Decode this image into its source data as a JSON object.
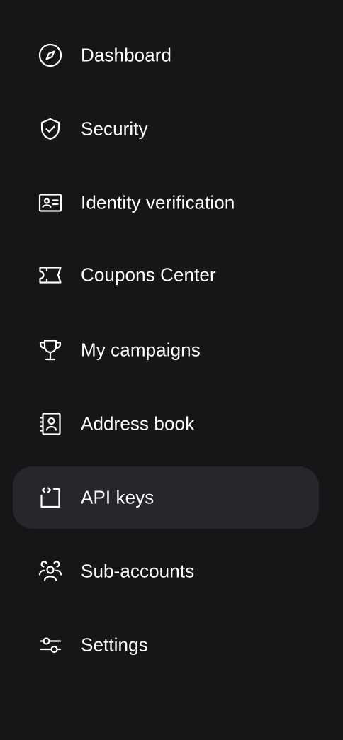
{
  "colors": {
    "background": "#161618",
    "active_item_background": "#26272b",
    "text": "#ffffff"
  },
  "sidebar": {
    "active_index": 6,
    "items": [
      {
        "label": "Dashboard",
        "icon": "compass-icon"
      },
      {
        "label": "Security",
        "icon": "shield-check-icon"
      },
      {
        "label": "Identity verification",
        "icon": "id-card-icon"
      },
      {
        "label": "Coupons Center",
        "icon": "ticket-icon"
      },
      {
        "label": "My campaigns",
        "icon": "trophy-icon"
      },
      {
        "label": "Address book",
        "icon": "contact-book-icon"
      },
      {
        "label": "API keys",
        "icon": "api-code-icon"
      },
      {
        "label": "Sub-accounts",
        "icon": "users-icon"
      },
      {
        "label": "Settings",
        "icon": "sliders-icon"
      }
    ]
  }
}
